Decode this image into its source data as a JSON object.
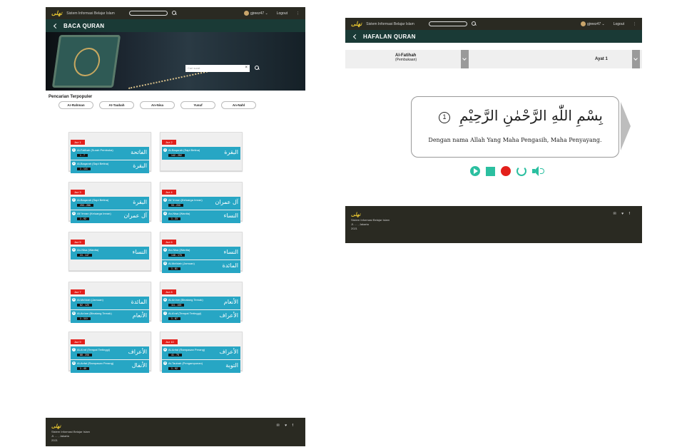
{
  "nav": {
    "logo": "ﻧﻬﻠﻰ",
    "site_title": "Sistem Informasi Belajar Islam",
    "user": "gjreez47 ⌄",
    "logout": "Logout",
    "kebab": "⋮"
  },
  "left": {
    "page_title": "BACA QURAN",
    "search_placeholder": "Cari surat",
    "popular_title": "Pencarian Terpopuler",
    "popular": [
      "Ar-Rahman",
      "At-Taubah",
      "An-Nisa",
      "Yusuf",
      "An-Nahl"
    ],
    "juz": [
      {
        "tag": "Juz 1",
        "surahs": [
          {
            "n": "1",
            "name": "Al-Fatihah (Surah Pembuka)",
            "range": "1 - 7",
            "arab": "الفاتحة"
          },
          {
            "n": "2",
            "name": "Al-Baqarah (Sapi Betina)",
            "range": "1 - 141",
            "arab": "البقرة"
          }
        ]
      },
      {
        "tag": "Juz 2",
        "surahs": [
          {
            "n": "2",
            "name": "Al-Baqarah (Sapi Betina)",
            "range": "142 - 252",
            "arab": "البقرة"
          }
        ]
      },
      {
        "tag": "Juz 3",
        "surahs": [
          {
            "n": "2",
            "name": "Al-Baqarah (Sapi Betina)",
            "range": "253 - 286",
            "arab": "البقرة"
          },
          {
            "n": "3",
            "name": "Ali 'Imran (Keluarga Imran)",
            "range": "1 - 92",
            "arab": "آل عمران"
          }
        ]
      },
      {
        "tag": "Juz 4",
        "surahs": [
          {
            "n": "3",
            "name": "Ali 'Imran (Keluarga Imran)",
            "range": "93 - 200",
            "arab": "آل عمران"
          },
          {
            "n": "4",
            "name": "An-Nisa (Wanita)",
            "range": "1 - 23",
            "arab": "النساء"
          }
        ]
      },
      {
        "tag": "Juz 5",
        "surahs": [
          {
            "n": "4",
            "name": "An-Nisa (Wanita)",
            "range": "24 - 147",
            "arab": "النساء"
          }
        ]
      },
      {
        "tag": "Juz 6",
        "surahs": [
          {
            "n": "4",
            "name": "An-Nisa (Wanita)",
            "range": "148 - 176",
            "arab": "النساء"
          },
          {
            "n": "5",
            "name": "Al-Ma'idah (Jamuan)",
            "range": "1 - 81",
            "arab": "المائدة"
          }
        ]
      },
      {
        "tag": "Juz 7",
        "surahs": [
          {
            "n": "5",
            "name": "Al-Ma'idah (Jamuan)",
            "range": "82 - 120",
            "arab": "المائدة"
          },
          {
            "n": "6",
            "name": "Al-An'am (Binatang Ternak)",
            "range": "1 - 110",
            "arab": "الأنعام"
          }
        ]
      },
      {
        "tag": "Juz 8",
        "surahs": [
          {
            "n": "6",
            "name": "Al-An'am (Binatang Ternak)",
            "range": "111 - 165",
            "arab": "الأنعام"
          },
          {
            "n": "7",
            "name": "Al-A'raf (Tempat Tertinggi)",
            "range": "1 - 87",
            "arab": "الأعراف"
          }
        ]
      },
      {
        "tag": "Juz 9",
        "surahs": [
          {
            "n": "7",
            "name": "Al-A'raf (Tempat Tertinggi)",
            "range": "88 - 206",
            "arab": "الأعراف"
          },
          {
            "n": "8",
            "name": "Al-Anfal (Rampasan Perang)",
            "range": "1 - 40",
            "arab": "الأنفال"
          }
        ]
      },
      {
        "tag": "Juz 10",
        "surahs": [
          {
            "n": "8",
            "name": "Al-Anfal (Rampasan Perang)",
            "range": "41 - 75",
            "arab": "الأعراف"
          },
          {
            "n": "9",
            "name": "At-Taubah (Pengampunan)",
            "range": "1 - 92",
            "arab": "التوبة"
          }
        ]
      }
    ]
  },
  "right": {
    "page_title": "HAFALAN QURAN",
    "surah_name": "Al-Fatihah",
    "surah_sub": "(Pembukaan)",
    "ayat_label": "Ayat 1",
    "ayah_arab": "بِسْمِ اللّٰهِ الرَّحْمٰنِ الرَّحِيْمِ",
    "ayah_no": "1",
    "ayah_translation": "Dengan nama Allah Yang Maha Pengasih, Maha Penyayang."
  },
  "footer": {
    "logo": "ﻧﻬﻠﻰ",
    "line1": "Sistem Informasi Belajar Islam",
    "line2": "Jl. ... , Jakarta",
    "line3": "2021",
    "icons": "✉ ♥ f"
  },
  "colors": {
    "accent": "#27a6c4",
    "juz_tag": "#e3201b",
    "nav": "#2a2a22",
    "header": "#1a3a36",
    "control": "#2bbfa0"
  }
}
